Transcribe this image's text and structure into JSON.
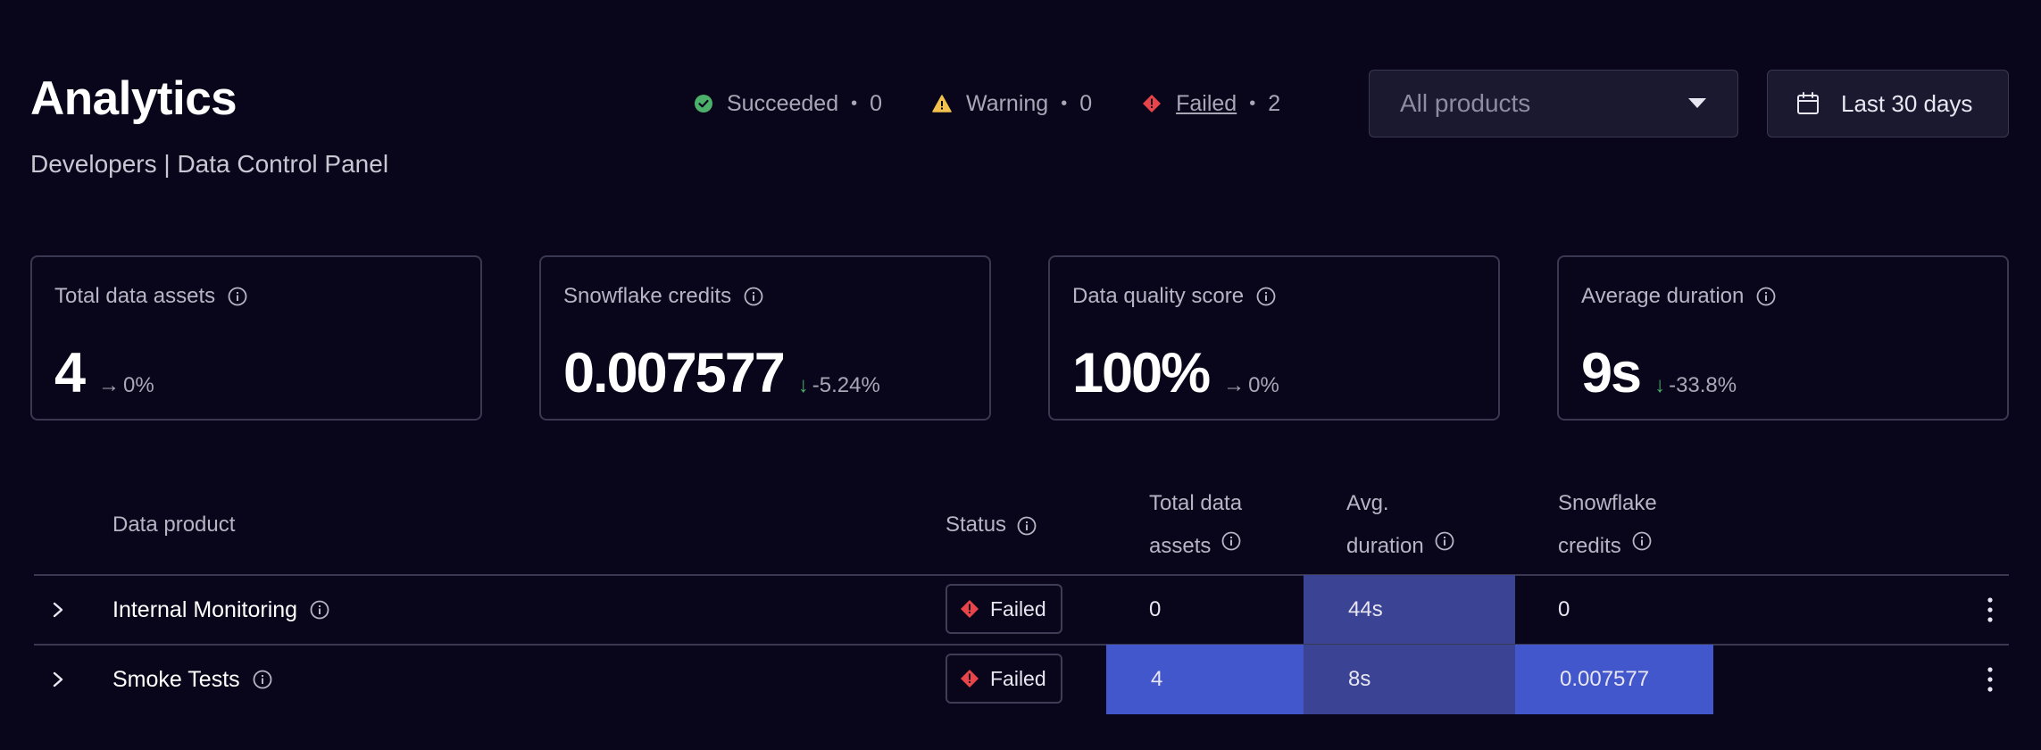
{
  "header": {
    "title": "Analytics",
    "subtitle": "Developers | Data Control Panel"
  },
  "status_summary": {
    "succeeded": {
      "label": "Succeeded",
      "count": "0",
      "color": "#4caf6a"
    },
    "warning": {
      "label": "Warning",
      "count": "0",
      "color": "#f2c14e"
    },
    "failed": {
      "label": "Failed",
      "count": "2",
      "color": "#e8444a"
    },
    "separator": "•"
  },
  "filters": {
    "product_select": {
      "value": "All products",
      "icon": "chevron-down-icon"
    },
    "date_range": {
      "label": "Last 30 days",
      "icon": "calendar-icon"
    }
  },
  "kpis": [
    {
      "label": "Total data assets",
      "value": "4",
      "arrow": "→",
      "delta": "0%",
      "trend": "flat"
    },
    {
      "label": "Snowflake credits",
      "value": "0.007577",
      "arrow": "↓",
      "delta": "-5.24%",
      "trend": "down"
    },
    {
      "label": "Data quality score",
      "value": "100%",
      "arrow": "→",
      "delta": "0%",
      "trend": "flat"
    },
    {
      "label": "Average duration",
      "value": "9s",
      "arrow": "↓",
      "delta": "-33.8%",
      "trend": "down"
    }
  ],
  "table": {
    "columns": {
      "product": "Data product",
      "status": "Status",
      "assets_line1": "Total data",
      "assets_line2": "assets",
      "duration_line1": "Avg.",
      "duration_line2": "duration",
      "credits_line1": "Snowflake",
      "credits_line2": "credits"
    },
    "rows": [
      {
        "name": "Internal Monitoring",
        "status": "Failed",
        "assets": "0",
        "duration": "44s",
        "credits": "0"
      },
      {
        "name": "Smoke Tests",
        "status": "Failed",
        "assets": "4",
        "duration": "8s",
        "credits": "0.007577"
      }
    ],
    "heatmap_colors": {
      "strong": "#4257cc",
      "medium": "#3a4394"
    }
  }
}
